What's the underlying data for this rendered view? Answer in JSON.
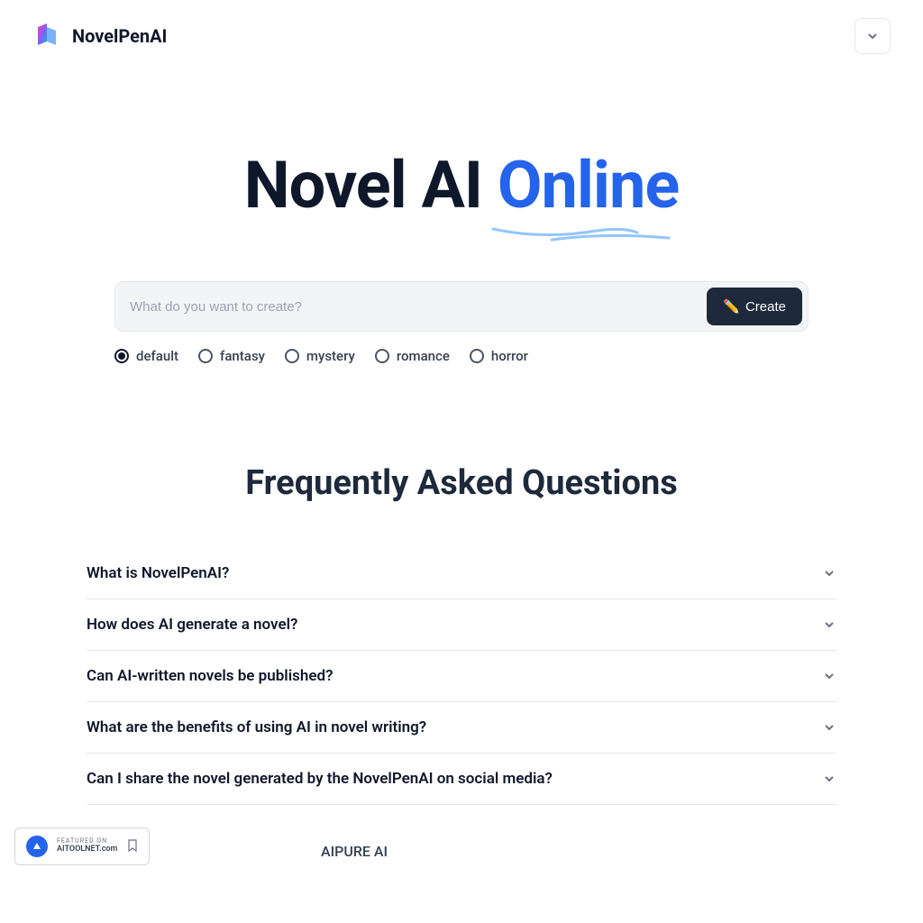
{
  "header": {
    "brand": "NovelPenAI"
  },
  "hero": {
    "word1": "Novel AI ",
    "word2": "Online"
  },
  "input": {
    "placeholder": "What do you want to create?",
    "button": "Create",
    "button_icon": "✏️"
  },
  "radios": [
    {
      "label": "default",
      "checked": true
    },
    {
      "label": "fantasy",
      "checked": false
    },
    {
      "label": "mystery",
      "checked": false
    },
    {
      "label": "romance",
      "checked": false
    },
    {
      "label": "horror",
      "checked": false
    }
  ],
  "faq": {
    "title": "Frequently Asked Questions",
    "items": [
      "What is NovelPenAI?",
      "How does AI generate a novel?",
      "Can AI-written novels be published?",
      "What are the benefits of using AI in novel writing?",
      "Can I share the novel generated by the NovelPenAI on social media?"
    ]
  },
  "badges": {
    "featured_on": "Featured on",
    "site": "AITOOLNET.com",
    "aipure": "AIPURE AI"
  }
}
